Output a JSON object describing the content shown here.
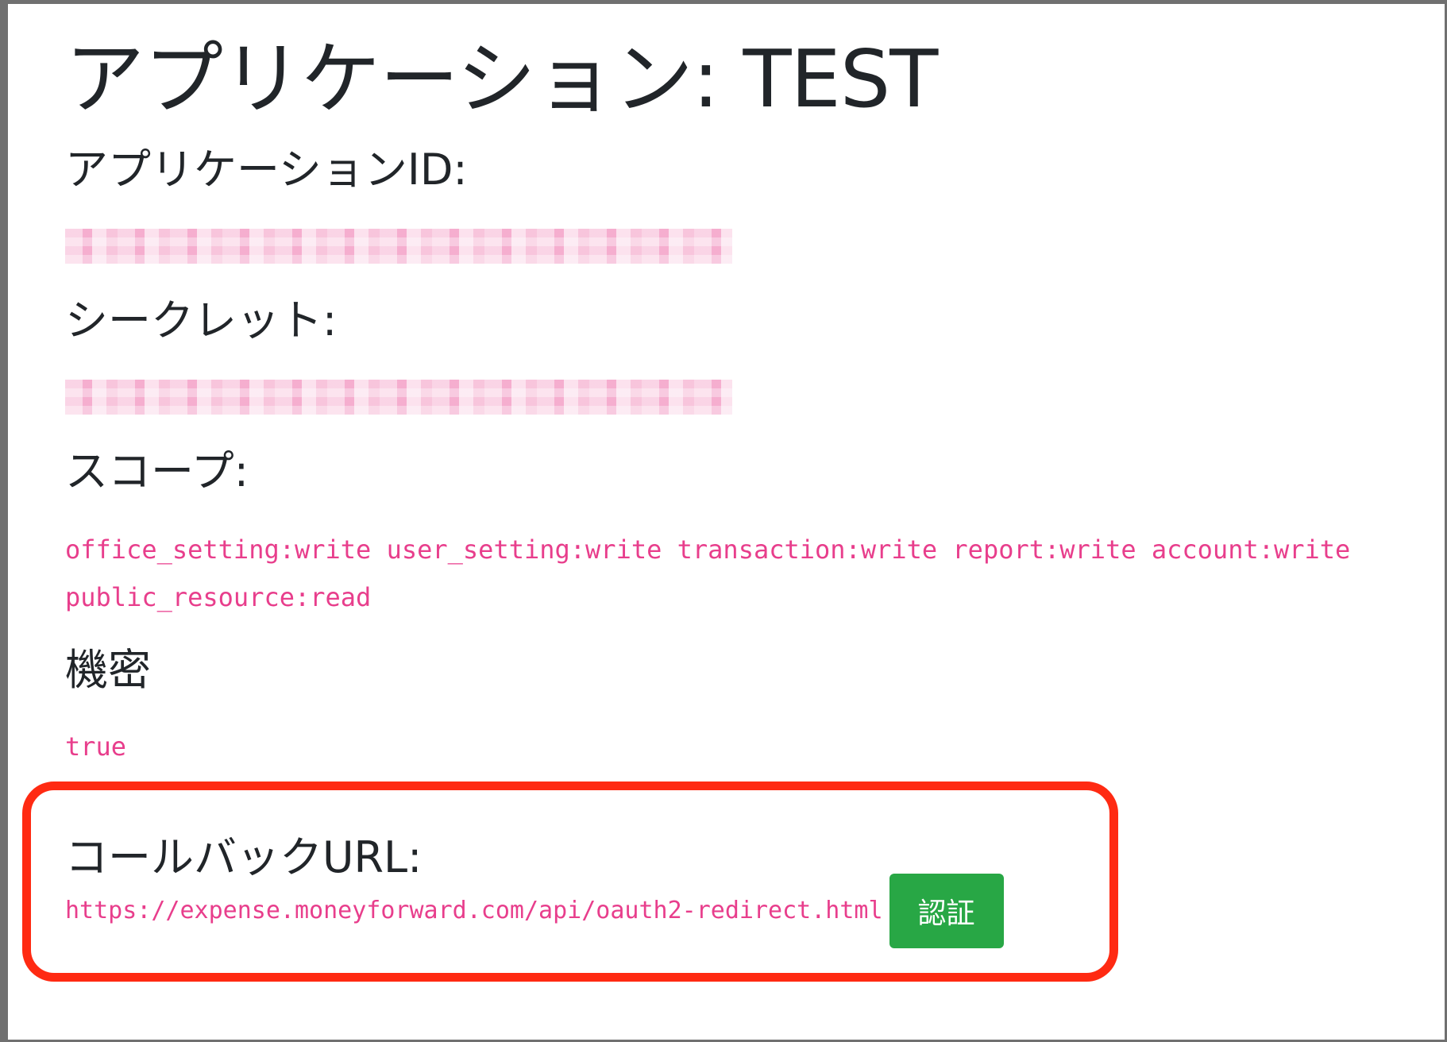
{
  "title": "アプリケーション: TEST",
  "fields": {
    "app_id": {
      "label": "アプリケーションID:",
      "value": ""
    },
    "secret": {
      "label": "シークレット:",
      "value": ""
    },
    "scope": {
      "label": "スコープ:",
      "value": "office_setting:write user_setting:write transaction:write report:write account:write public_resource:read"
    },
    "confidential": {
      "label": "機密",
      "value": "true"
    },
    "callback": {
      "label": "コールバックURL:",
      "value": "https://expense.moneyforward.com/api/oauth2-redirect.html",
      "button_label": "認証"
    }
  },
  "colors": {
    "code": "#e83e8c",
    "button": "#28a745",
    "highlight": "#ff2a12",
    "frame": "#707070"
  }
}
